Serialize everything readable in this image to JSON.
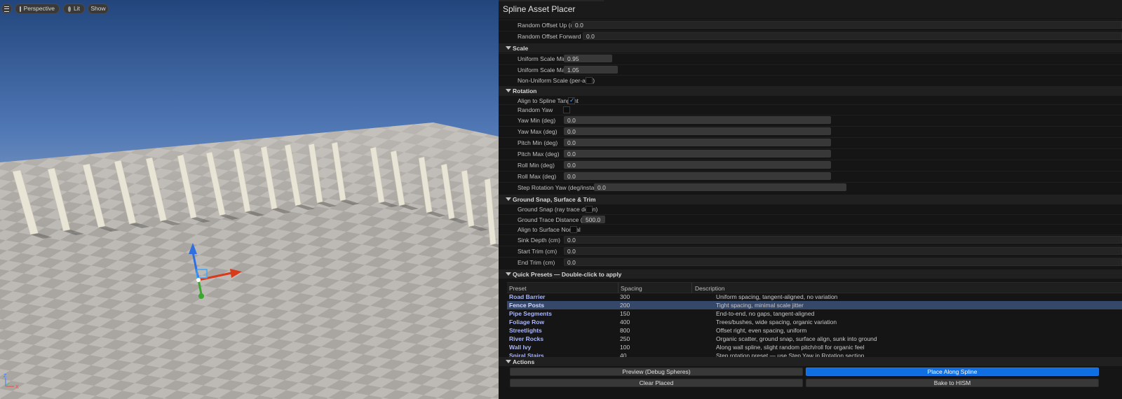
{
  "viewport": {
    "perspective_label": "Perspective",
    "lit_label": "Lit",
    "show_label": "Show",
    "axis_z": "Z",
    "axis_x": "X"
  },
  "panel": {
    "title": "Spline Asset Placer",
    "offsets": [
      {
        "label": "Random Offset Up (cm)",
        "value": "0.0"
      },
      {
        "label": "Random Offset Forward (cm)",
        "value": "0.0"
      }
    ],
    "scale": {
      "header": "Scale",
      "uniform_min_label": "Uniform Scale Min",
      "uniform_min_value": "0.95",
      "uniform_max_label": "Uniform Scale Max",
      "uniform_max_value": "1.05",
      "non_uniform_label": "Non-Uniform Scale (per-axis)",
      "non_uniform_checked": false
    },
    "rotation": {
      "header": "Rotation",
      "align_tangent_label": "Align to Spline Tangent",
      "align_tangent_checked": true,
      "random_yaw_label": "Random Yaw",
      "random_yaw_checked": false,
      "fields": [
        {
          "label": "Yaw Min (deg)",
          "value": "0.0"
        },
        {
          "label": "Yaw Max (deg)",
          "value": "0.0"
        },
        {
          "label": "Pitch Min (deg)",
          "value": "0.0"
        },
        {
          "label": "Pitch Max (deg)",
          "value": "0.0"
        },
        {
          "label": "Roll Min (deg)",
          "value": "0.0"
        },
        {
          "label": "Roll Max (deg)",
          "value": "0.0"
        }
      ],
      "step_yaw_label": "Step Rotation Yaw (deg/instance)",
      "step_yaw_value": "0.0"
    },
    "ground": {
      "header": "Ground Snap, Surface & Trim",
      "ground_snap_label": "Ground Snap (ray trace down)",
      "ground_snap_checked": false,
      "trace_distance_label": "Ground Trace Distance (cm)",
      "trace_distance_value": "500.0",
      "align_normal_label": "Align to Surface Normal",
      "align_normal_checked": false,
      "sink_label": "Sink Depth (cm)",
      "sink_value": "0.0",
      "start_trim_label": "Start Trim (cm)",
      "start_trim_value": "0.0",
      "end_trim_label": "End Trim (cm)",
      "end_trim_value": "0.0"
    },
    "presets": {
      "header": "Quick Presets — Double-click to apply",
      "columns": [
        "Preset",
        "Spacing",
        "Description"
      ],
      "rows": [
        {
          "name": "Road Barrier",
          "spacing": "300",
          "description": "Uniform spacing, tangent-aligned, no variation"
        },
        {
          "name": "Fence Posts",
          "spacing": "200",
          "description": "Tight spacing, minimal scale jitter"
        },
        {
          "name": "Pipe Segments",
          "spacing": "150",
          "description": "End-to-end, no gaps, tangent-aligned"
        },
        {
          "name": "Foliage Row",
          "spacing": "400",
          "description": "Trees/bushes, wide spacing, organic variation"
        },
        {
          "name": "Streetlights",
          "spacing": "800",
          "description": "Offset right, even spacing, uniform"
        },
        {
          "name": "River Rocks",
          "spacing": "250",
          "description": "Organic scatter, ground snap, surface align, sunk into ground"
        },
        {
          "name": "Wall Ivy",
          "spacing": "100",
          "description": "Along wall spline, slight random pitch/roll for organic feel"
        },
        {
          "name": "Spiral Stairs",
          "spacing": "40",
          "description": "Step rotation preset — use Step Yaw in Rotation section"
        }
      ],
      "selected_index": 1
    },
    "actions": {
      "header": "Actions",
      "preview_label": "Preview (Debug Spheres)",
      "place_label": "Place Along Spline",
      "clear_label": "Clear Placed",
      "bake_label": "Bake to HISM"
    }
  }
}
